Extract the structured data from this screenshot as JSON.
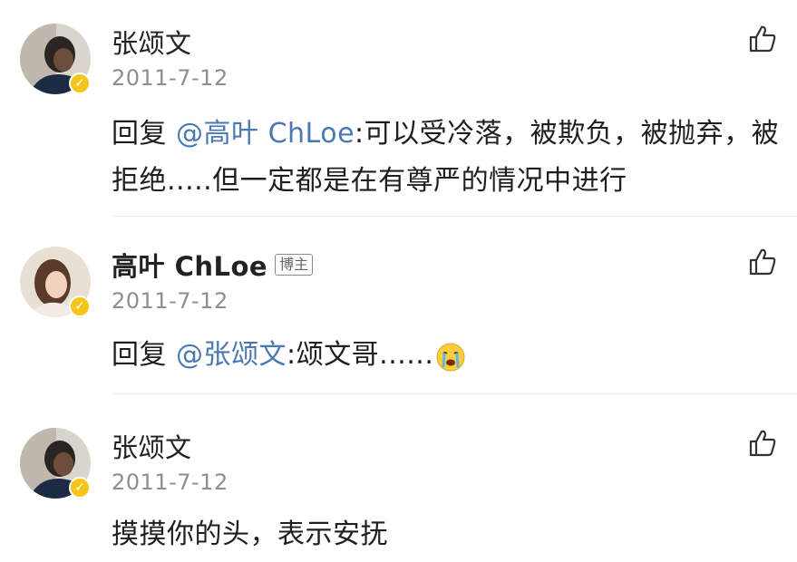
{
  "comments": [
    {
      "author": "张颂文",
      "date": "2011-7-12",
      "reply_prefix": "回复 ",
      "mention": "@高叶 ChLoe",
      "text": ":可以受冷落，被欺负，被抛弃，被拒绝.....但一定都是在有尊严的情况中进行",
      "verified_mark": "✓",
      "icons": [
        "avatar",
        "verified-badge-icon",
        "like-icon"
      ]
    },
    {
      "author": "高叶 ChLoe",
      "tag": "博主",
      "date": "2011-7-12",
      "reply_prefix": "回复 ",
      "mention": "@张颂文",
      "text": ":颂文哥......",
      "verified_mark": "✓",
      "icons": [
        "avatar",
        "verified-badge-icon",
        "like-icon",
        "crying-emoji-icon"
      ]
    },
    {
      "author": "张颂文",
      "date": "2011-7-12",
      "text": "摸摸你的头，表示安抚",
      "verified_mark": "✓",
      "icons": [
        "avatar",
        "verified-badge-icon",
        "like-icon"
      ]
    }
  ],
  "colors": {
    "mention": "#4a78b0",
    "date": "#8e8e8e",
    "verified": "#f5c518",
    "divider": "#ececec"
  }
}
